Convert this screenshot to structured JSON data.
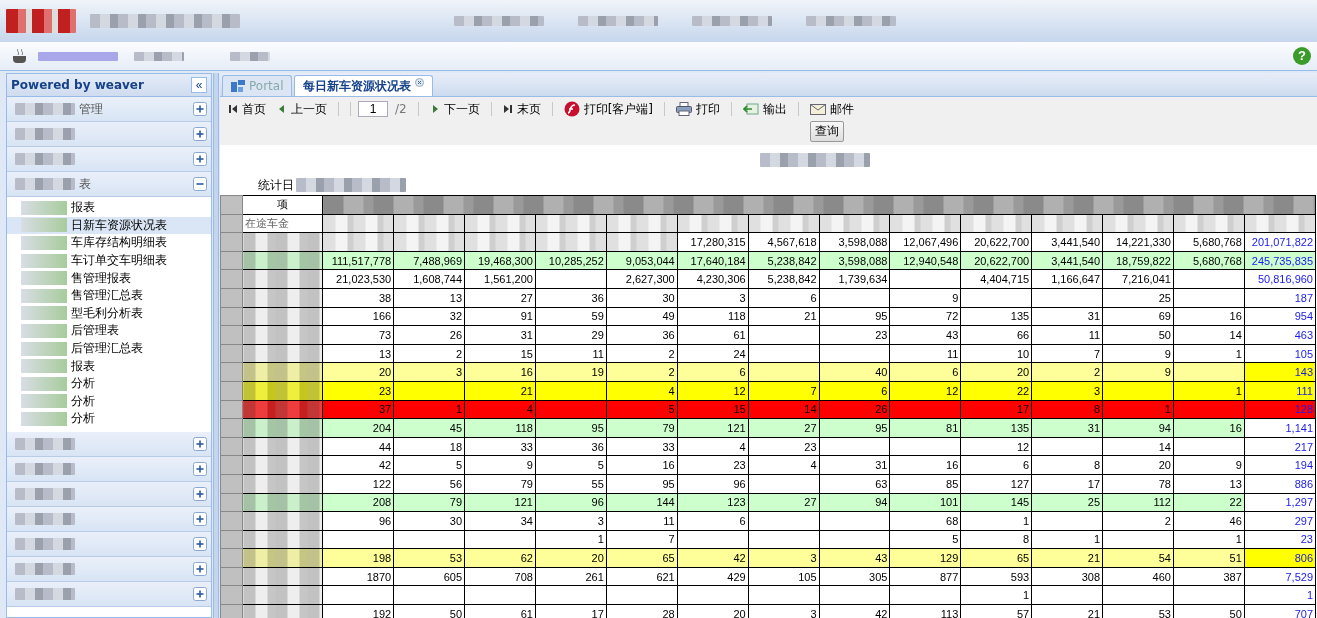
{
  "topbar": {
    "help_glyph": "?"
  },
  "sidebar": {
    "title": "Powered by weaver",
    "collapse_glyph": "«",
    "sections": [
      {
        "title": "管理",
        "expanded": false
      },
      {
        "expanded": false
      },
      {
        "expanded": false
      },
      {
        "title": "表",
        "expanded": true,
        "items": [
          {
            "label": "报表",
            "selected": false
          },
          {
            "label": "日新车资源状况表",
            "selected": true
          },
          {
            "label": "车库存结构明细表",
            "selected": false
          },
          {
            "label": "车订单交车明细表",
            "selected": false
          },
          {
            "label": "售管理报表",
            "selected": false
          },
          {
            "label": "售管理汇总表",
            "selected": false
          },
          {
            "label": "型毛利分析表",
            "selected": false
          },
          {
            "label": "后管理表",
            "selected": false
          },
          {
            "label": "后管理汇总表",
            "selected": false
          },
          {
            "label": "报表",
            "selected": false
          },
          {
            "label": "分析",
            "selected": false
          },
          {
            "label": "分析",
            "selected": false
          },
          {
            "label": "分析",
            "selected": false
          }
        ]
      },
      {
        "expanded": false
      },
      {
        "expanded": false
      },
      {
        "expanded": false
      },
      {
        "expanded": false
      },
      {
        "expanded": false
      },
      {
        "expanded": false
      },
      {
        "expanded": false
      }
    ]
  },
  "tabs": [
    {
      "label": "Portal",
      "selected": false,
      "kind": "portal"
    },
    {
      "label": "每日新车资源状况表",
      "selected": true,
      "kind": "closable"
    }
  ],
  "toolbar": {
    "items": [
      {
        "kind": "first",
        "label": "首页"
      },
      {
        "kind": "prev",
        "label": "上一页"
      },
      {
        "kind": "page",
        "value": "1",
        "label": "/2"
      },
      {
        "kind": "next",
        "label": "下一页"
      },
      {
        "kind": "last",
        "label": "末页"
      },
      {
        "kind": "client_print",
        "label": "打印[客户端]"
      },
      {
        "kind": "print",
        "label": "打印"
      },
      {
        "kind": "export",
        "label": "输出"
      },
      {
        "kind": "mail",
        "label": "邮件"
      }
    ],
    "query_button": "查询"
  },
  "report": {
    "date_label": "统计日",
    "header_label": "项",
    "rows": [
      {
        "label": "在途车金",
        "cells": [
          {
            "kind": "blurred"
          },
          {
            "kind": "blurred"
          },
          {
            "kind": "blurred"
          },
          {
            "kind": "blurred"
          },
          {
            "kind": "blurred"
          },
          {
            "kind": "blurred"
          },
          {
            "kind": "blurred"
          },
          {
            "kind": "blurred"
          },
          {
            "kind": "blurred"
          },
          {
            "kind": "blurred"
          },
          {
            "kind": "blurred"
          },
          {
            "kind": "blurred"
          },
          {
            "kind": "blurred"
          },
          {
            "kind": "blurred"
          }
        ]
      },
      {
        "cells": [
          {
            "kind": "blurred"
          },
          {
            "kind": "blurred"
          },
          {
            "kind": "blurred"
          },
          {
            "kind": "blurred"
          },
          {
            "kind": "blurred"
          },
          {
            "kind": "num",
            "t": "17,280,315"
          },
          {
            "kind": "num",
            "t": "4,567,618"
          },
          {
            "kind": "num",
            "t": "3,598,088"
          },
          {
            "kind": "num",
            "t": "12,067,496"
          },
          {
            "kind": "num",
            "t": "20,622,700"
          },
          {
            "kind": "num",
            "t": "3,441,540"
          },
          {
            "kind": "num",
            "t": "14,221,330"
          },
          {
            "kind": "num",
            "t": "5,680,768"
          },
          {
            "kind": "num",
            "t": "201,071,822"
          }
        ]
      },
      {
        "cells": [
          {
            "kind": "num",
            "t": "111,517,778",
            "color": "#ccffcc"
          },
          {
            "kind": "num",
            "t": "7,488,969",
            "color": "#ccffcc"
          },
          {
            "kind": "num",
            "t": "19,468,300",
            "color": "#ccffcc"
          },
          {
            "kind": "num",
            "t": "10,285,252",
            "color": "#ccffcc"
          },
          {
            "kind": "num",
            "t": "9,053,044",
            "color": "#ccffcc"
          },
          {
            "kind": "num",
            "t": "17,640,184",
            "color": "#ccffcc"
          },
          {
            "kind": "num",
            "t": "5,238,842",
            "color": "#ccffcc"
          },
          {
            "kind": "num",
            "t": "3,598,088",
            "color": "#ccffcc"
          },
          {
            "kind": "num",
            "t": "12,940,548",
            "color": "#ccffcc"
          },
          {
            "kind": "num",
            "t": "20,622,700",
            "color": "#ccffcc"
          },
          {
            "kind": "num",
            "t": "3,441,540",
            "color": "#ccffcc"
          },
          {
            "kind": "num",
            "t": "18,759,822",
            "color": "#ccffcc"
          },
          {
            "kind": "num",
            "t": "5,680,768",
            "color": "#ccffcc"
          },
          {
            "kind": "num",
            "t": "245,735,835",
            "color": "#ccffcc"
          }
        ]
      },
      {
        "cells": [
          {
            "kind": "num",
            "t": "21,023,530"
          },
          {
            "kind": "num",
            "t": "1,608,744"
          },
          {
            "kind": "num",
            "t": "1,561,200"
          },
          {
            "kind": "empty"
          },
          {
            "kind": "num",
            "t": "2,627,300"
          },
          {
            "kind": "num",
            "t": "4,230,306"
          },
          {
            "kind": "num",
            "t": "5,238,842"
          },
          {
            "kind": "num",
            "t": "1,739,634"
          },
          {
            "kind": "empty"
          },
          {
            "kind": "num",
            "t": "4,404,715"
          },
          {
            "kind": "num",
            "t": "1,166,647"
          },
          {
            "kind": "num",
            "t": "7,216,041"
          },
          {
            "kind": "empty"
          },
          {
            "kind": "num",
            "t": "50,816,960"
          }
        ]
      },
      {
        "cells": [
          {
            "kind": "num",
            "t": "38"
          },
          {
            "kind": "num",
            "t": "13"
          },
          {
            "kind": "num",
            "t": "27"
          },
          {
            "kind": "num",
            "t": "36"
          },
          {
            "kind": "num",
            "t": "30"
          },
          {
            "kind": "num",
            "t": "3"
          },
          {
            "kind": "num",
            "t": "6"
          },
          {
            "kind": "empty"
          },
          {
            "kind": "num",
            "t": "9"
          },
          {
            "kind": "empty"
          },
          {
            "kind": "empty"
          },
          {
            "kind": "num",
            "t": "25"
          },
          {
            "kind": "empty"
          },
          {
            "kind": "num",
            "t": "187"
          }
        ]
      },
      {
        "cells": [
          {
            "kind": "num",
            "t": "166"
          },
          {
            "kind": "num",
            "t": "32"
          },
          {
            "kind": "num",
            "t": "91"
          },
          {
            "kind": "num",
            "t": "59"
          },
          {
            "kind": "num",
            "t": "49"
          },
          {
            "kind": "num",
            "t": "118"
          },
          {
            "kind": "num",
            "t": "21"
          },
          {
            "kind": "num",
            "t": "95"
          },
          {
            "kind": "num",
            "t": "72"
          },
          {
            "kind": "num",
            "t": "135"
          },
          {
            "kind": "num",
            "t": "31"
          },
          {
            "kind": "num",
            "t": "69"
          },
          {
            "kind": "num",
            "t": "16"
          },
          {
            "kind": "num",
            "t": "954"
          }
        ]
      },
      {
        "cells": [
          {
            "kind": "num",
            "t": "73"
          },
          {
            "kind": "num",
            "t": "26"
          },
          {
            "kind": "num",
            "t": "31"
          },
          {
            "kind": "num",
            "t": "29"
          },
          {
            "kind": "num",
            "t": "36"
          },
          {
            "kind": "num",
            "t": "61"
          },
          {
            "kind": "empty"
          },
          {
            "kind": "num",
            "t": "23"
          },
          {
            "kind": "num",
            "t": "43"
          },
          {
            "kind": "num",
            "t": "66"
          },
          {
            "kind": "num",
            "t": "11"
          },
          {
            "kind": "num",
            "t": "50"
          },
          {
            "kind": "num",
            "t": "14"
          },
          {
            "kind": "num",
            "t": "463"
          }
        ]
      },
      {
        "cells": [
          {
            "kind": "num",
            "t": "13"
          },
          {
            "kind": "num",
            "t": "2"
          },
          {
            "kind": "num",
            "t": "15"
          },
          {
            "kind": "num",
            "t": "11"
          },
          {
            "kind": "num",
            "t": "2"
          },
          {
            "kind": "num",
            "t": "24"
          },
          {
            "kind": "empty"
          },
          {
            "kind": "empty"
          },
          {
            "kind": "num",
            "t": "11"
          },
          {
            "kind": "num",
            "t": "10"
          },
          {
            "kind": "num",
            "t": "7"
          },
          {
            "kind": "num",
            "t": "9"
          },
          {
            "kind": "num",
            "t": "1"
          },
          {
            "kind": "num",
            "t": "105"
          }
        ]
      },
      {
        "cells": [
          {
            "kind": "num",
            "t": "20",
            "color": "#ffff99"
          },
          {
            "kind": "num",
            "t": "3",
            "color": "#ffff99"
          },
          {
            "kind": "num",
            "t": "16",
            "color": "#ffff99"
          },
          {
            "kind": "num",
            "t": "19",
            "color": "#ffff99"
          },
          {
            "kind": "num",
            "t": "2",
            "color": "#ffff99"
          },
          {
            "kind": "num",
            "t": "6",
            "color": "#ffff99"
          },
          {
            "kind": "empty",
            "color": "#ffff99"
          },
          {
            "kind": "num",
            "t": "40",
            "color": "#ffff99"
          },
          {
            "kind": "num",
            "t": "6",
            "color": "#ffff99"
          },
          {
            "kind": "num",
            "t": "20",
            "color": "#ffff99"
          },
          {
            "kind": "num",
            "t": "2",
            "color": "#ffff99"
          },
          {
            "kind": "num",
            "t": "9",
            "color": "#ffff99"
          },
          {
            "kind": "empty",
            "color": "#ffff99"
          },
          {
            "kind": "num",
            "t": "143",
            "color": "#ffff00"
          }
        ]
      },
      {
        "cells": [
          {
            "kind": "num",
            "t": "23",
            "color": "#ffff00"
          },
          {
            "kind": "empty",
            "color": "#ffff00"
          },
          {
            "kind": "num",
            "t": "21",
            "color": "#ffff00"
          },
          {
            "kind": "empty",
            "color": "#ffff00"
          },
          {
            "kind": "num",
            "t": "4",
            "color": "#ffff00"
          },
          {
            "kind": "num",
            "t": "12",
            "color": "#ffff00"
          },
          {
            "kind": "num",
            "t": "7",
            "color": "#ffff00"
          },
          {
            "kind": "num",
            "t": "6",
            "color": "#ffff00"
          },
          {
            "kind": "num",
            "t": "12",
            "color": "#ffff00"
          },
          {
            "kind": "num",
            "t": "22",
            "color": "#ffff00"
          },
          {
            "kind": "num",
            "t": "3",
            "color": "#ffff00"
          },
          {
            "kind": "empty",
            "color": "#ffff00"
          },
          {
            "kind": "num",
            "t": "1",
            "color": "#ffff00"
          },
          {
            "kind": "num",
            "t": "111",
            "color": "#ffff00"
          }
        ]
      },
      {
        "cells": [
          {
            "kind": "num",
            "t": "37",
            "color": "#ff0000"
          },
          {
            "kind": "num",
            "t": "1",
            "color": "#ff0000"
          },
          {
            "kind": "num",
            "t": "4",
            "color": "#ff0000"
          },
          {
            "kind": "empty",
            "color": "#ff0000"
          },
          {
            "kind": "num",
            "t": "5",
            "color": "#ff0000"
          },
          {
            "kind": "num",
            "t": "15",
            "color": "#ff0000"
          },
          {
            "kind": "num",
            "t": "14",
            "color": "#ff0000"
          },
          {
            "kind": "num",
            "t": "26",
            "color": "#ff0000"
          },
          {
            "kind": "empty",
            "color": "#ff0000"
          },
          {
            "kind": "num",
            "t": "17",
            "color": "#ff0000"
          },
          {
            "kind": "num",
            "t": "8",
            "color": "#ff0000"
          },
          {
            "kind": "num",
            "t": "1",
            "color": "#ff0000"
          },
          {
            "kind": "empty",
            "color": "#ff0000"
          },
          {
            "kind": "num",
            "t": "128",
            "color": "#ff0000"
          }
        ]
      },
      {
        "cells": [
          {
            "kind": "num",
            "t": "204",
            "color": "#ccffcc"
          },
          {
            "kind": "num",
            "t": "45",
            "color": "#ccffcc"
          },
          {
            "kind": "num",
            "t": "118",
            "color": "#ccffcc"
          },
          {
            "kind": "num",
            "t": "95",
            "color": "#ccffcc"
          },
          {
            "kind": "num",
            "t": "79",
            "color": "#ccffcc"
          },
          {
            "kind": "num",
            "t": "121",
            "color": "#ccffcc"
          },
          {
            "kind": "num",
            "t": "27",
            "color": "#ccffcc"
          },
          {
            "kind": "num",
            "t": "95",
            "color": "#ccffcc"
          },
          {
            "kind": "num",
            "t": "81",
            "color": "#ccffcc"
          },
          {
            "kind": "num",
            "t": "135",
            "color": "#ccffcc"
          },
          {
            "kind": "num",
            "t": "31",
            "color": "#ccffcc"
          },
          {
            "kind": "num",
            "t": "94",
            "color": "#ccffcc"
          },
          {
            "kind": "num",
            "t": "16",
            "color": "#ccffcc"
          },
          {
            "kind": "num",
            "t": "1,141"
          }
        ]
      },
      {
        "cells": [
          {
            "kind": "num",
            "t": "44"
          },
          {
            "kind": "num",
            "t": "18"
          },
          {
            "kind": "num",
            "t": "33"
          },
          {
            "kind": "num",
            "t": "36"
          },
          {
            "kind": "num",
            "t": "33"
          },
          {
            "kind": "num",
            "t": "4"
          },
          {
            "kind": "num",
            "t": "23"
          },
          {
            "kind": "empty"
          },
          {
            "kind": "empty"
          },
          {
            "kind": "num",
            "t": "12"
          },
          {
            "kind": "empty"
          },
          {
            "kind": "num",
            "t": "14"
          },
          {
            "kind": "empty"
          },
          {
            "kind": "num",
            "t": "217"
          }
        ]
      },
      {
        "cells": [
          {
            "kind": "num",
            "t": "42"
          },
          {
            "kind": "num",
            "t": "5"
          },
          {
            "kind": "num",
            "t": "9"
          },
          {
            "kind": "num",
            "t": "5"
          },
          {
            "kind": "num",
            "t": "16"
          },
          {
            "kind": "num",
            "t": "23"
          },
          {
            "kind": "num",
            "t": "4"
          },
          {
            "kind": "num",
            "t": "31"
          },
          {
            "kind": "num",
            "t": "16"
          },
          {
            "kind": "num",
            "t": "6"
          },
          {
            "kind": "num",
            "t": "8"
          },
          {
            "kind": "num",
            "t": "20"
          },
          {
            "kind": "num",
            "t": "9"
          },
          {
            "kind": "num",
            "t": "194"
          }
        ]
      },
      {
        "cells": [
          {
            "kind": "num",
            "t": "122"
          },
          {
            "kind": "num",
            "t": "56"
          },
          {
            "kind": "num",
            "t": "79"
          },
          {
            "kind": "num",
            "t": "55"
          },
          {
            "kind": "num",
            "t": "95"
          },
          {
            "kind": "num",
            "t": "96"
          },
          {
            "kind": "empty"
          },
          {
            "kind": "num",
            "t": "63"
          },
          {
            "kind": "num",
            "t": "85"
          },
          {
            "kind": "num",
            "t": "127"
          },
          {
            "kind": "num",
            "t": "17"
          },
          {
            "kind": "num",
            "t": "78"
          },
          {
            "kind": "num",
            "t": "13"
          },
          {
            "kind": "num",
            "t": "886"
          }
        ]
      },
      {
        "cells": [
          {
            "kind": "num",
            "t": "208",
            "color": "#ccffcc"
          },
          {
            "kind": "num",
            "t": "79",
            "color": "#ccffcc"
          },
          {
            "kind": "num",
            "t": "121",
            "color": "#ccffcc"
          },
          {
            "kind": "num",
            "t": "96",
            "color": "#ccffcc"
          },
          {
            "kind": "num",
            "t": "144",
            "color": "#ccffcc"
          },
          {
            "kind": "num",
            "t": "123",
            "color": "#ccffcc"
          },
          {
            "kind": "num",
            "t": "27",
            "color": "#ccffcc"
          },
          {
            "kind": "num",
            "t": "94",
            "color": "#ccffcc"
          },
          {
            "kind": "num",
            "t": "101",
            "color": "#ccffcc"
          },
          {
            "kind": "num",
            "t": "145",
            "color": "#ccffcc"
          },
          {
            "kind": "num",
            "t": "25",
            "color": "#ccffcc"
          },
          {
            "kind": "num",
            "t": "112",
            "color": "#ccffcc"
          },
          {
            "kind": "num",
            "t": "22",
            "color": "#ccffcc"
          },
          {
            "kind": "num",
            "t": "1,297"
          }
        ]
      },
      {
        "cells": [
          {
            "kind": "num",
            "t": "96"
          },
          {
            "kind": "num",
            "t": "30"
          },
          {
            "kind": "num",
            "t": "34"
          },
          {
            "kind": "num",
            "t": "3"
          },
          {
            "kind": "num",
            "t": "11"
          },
          {
            "kind": "num",
            "t": "6"
          },
          {
            "kind": "empty"
          },
          {
            "kind": "empty"
          },
          {
            "kind": "num",
            "t": "68"
          },
          {
            "kind": "num",
            "t": "1"
          },
          {
            "kind": "empty"
          },
          {
            "kind": "num",
            "t": "2"
          },
          {
            "kind": "num",
            "t": "46"
          },
          {
            "kind": "num",
            "t": "297"
          }
        ]
      },
      {
        "cells": [
          {
            "kind": "empty"
          },
          {
            "kind": "empty"
          },
          {
            "kind": "empty"
          },
          {
            "kind": "num",
            "t": "1"
          },
          {
            "kind": "num",
            "t": "7"
          },
          {
            "kind": "empty"
          },
          {
            "kind": "empty"
          },
          {
            "kind": "empty"
          },
          {
            "kind": "num",
            "t": "5"
          },
          {
            "kind": "num",
            "t": "8"
          },
          {
            "kind": "num",
            "t": "1"
          },
          {
            "kind": "empty"
          },
          {
            "kind": "num",
            "t": "1"
          },
          {
            "kind": "num",
            "t": "23"
          }
        ]
      },
      {
        "cells": [
          {
            "kind": "num",
            "t": "198",
            "color": "#ffff99"
          },
          {
            "kind": "num",
            "t": "53",
            "color": "#ffff99"
          },
          {
            "kind": "num",
            "t": "62",
            "color": "#ffff99"
          },
          {
            "kind": "num",
            "t": "20",
            "color": "#ffff99"
          },
          {
            "kind": "num",
            "t": "65",
            "color": "#ffff99"
          },
          {
            "kind": "num",
            "t": "42",
            "color": "#ffff99"
          },
          {
            "kind": "num",
            "t": "3",
            "color": "#ffff99"
          },
          {
            "kind": "num",
            "t": "43",
            "color": "#ffff99"
          },
          {
            "kind": "num",
            "t": "129",
            "color": "#ffff99"
          },
          {
            "kind": "num",
            "t": "65",
            "color": "#ffff99"
          },
          {
            "kind": "num",
            "t": "21",
            "color": "#ffff99"
          },
          {
            "kind": "num",
            "t": "54",
            "color": "#ffff99"
          },
          {
            "kind": "num",
            "t": "51",
            "color": "#ffff99"
          },
          {
            "kind": "num",
            "t": "806",
            "color": "#ffff00"
          }
        ]
      },
      {
        "cells": [
          {
            "kind": "num",
            "t": "1870"
          },
          {
            "kind": "num",
            "t": "605"
          },
          {
            "kind": "num",
            "t": "708"
          },
          {
            "kind": "num",
            "t": "261"
          },
          {
            "kind": "num",
            "t": "621"
          },
          {
            "kind": "num",
            "t": "429"
          },
          {
            "kind": "num",
            "t": "105"
          },
          {
            "kind": "num",
            "t": "305"
          },
          {
            "kind": "num",
            "t": "877"
          },
          {
            "kind": "num",
            "t": "593"
          },
          {
            "kind": "num",
            "t": "308"
          },
          {
            "kind": "num",
            "t": "460"
          },
          {
            "kind": "num",
            "t": "387"
          },
          {
            "kind": "num",
            "t": "7,529"
          }
        ]
      },
      {
        "cells": [
          {
            "kind": "empty"
          },
          {
            "kind": "empty"
          },
          {
            "kind": "empty"
          },
          {
            "kind": "empty"
          },
          {
            "kind": "empty"
          },
          {
            "kind": "empty"
          },
          {
            "kind": "empty"
          },
          {
            "kind": "empty"
          },
          {
            "kind": "empty"
          },
          {
            "kind": "num",
            "t": "1"
          },
          {
            "kind": "empty"
          },
          {
            "kind": "empty"
          },
          {
            "kind": "empty"
          },
          {
            "kind": "num",
            "t": "1"
          }
        ]
      },
      {
        "cells": [
          {
            "kind": "num",
            "t": "192"
          },
          {
            "kind": "num",
            "t": "50"
          },
          {
            "kind": "num",
            "t": "61"
          },
          {
            "kind": "num",
            "t": "17"
          },
          {
            "kind": "num",
            "t": "28"
          },
          {
            "kind": "num",
            "t": "20"
          },
          {
            "kind": "num",
            "t": "3"
          },
          {
            "kind": "num",
            "t": "42"
          },
          {
            "kind": "num",
            "t": "113"
          },
          {
            "kind": "num",
            "t": "57"
          },
          {
            "kind": "num",
            "t": "21"
          },
          {
            "kind": "num",
            "t": "53"
          },
          {
            "kind": "num",
            "t": "50"
          },
          {
            "kind": "num",
            "t": "707"
          }
        ]
      }
    ]
  }
}
